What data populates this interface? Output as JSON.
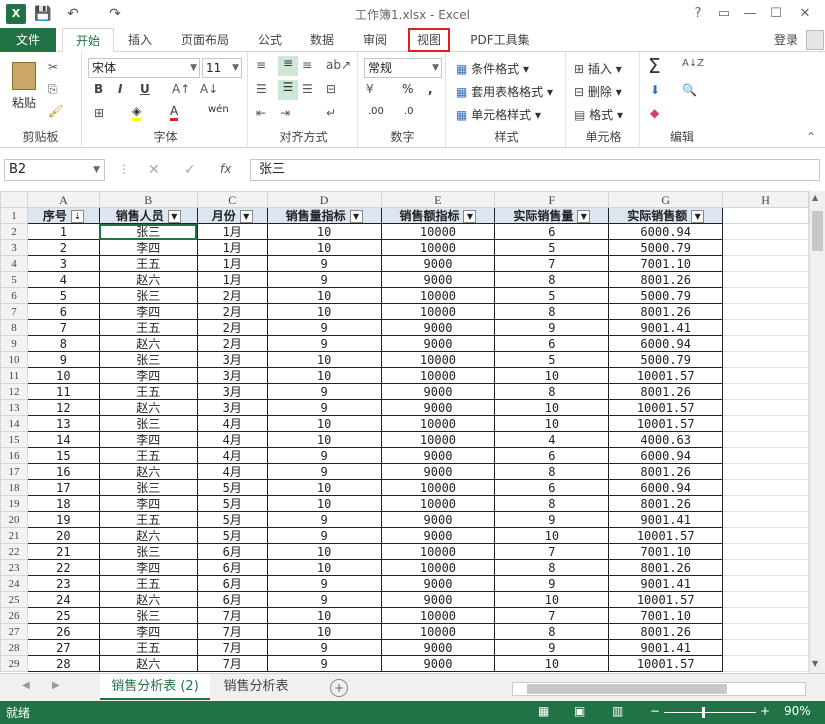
{
  "window": {
    "title": "工作簿1.xlsx - Excel",
    "app_icon": "X",
    "controls": [
      "?",
      "▭",
      "—",
      "☐",
      "✕"
    ]
  },
  "quick_access": {
    "save": "💾",
    "undo": "↶",
    "redo": "↷"
  },
  "tabs": [
    "文件",
    "开始",
    "插入",
    "页面布局",
    "公式",
    "数据",
    "审阅",
    "视图",
    "PDF工具集"
  ],
  "login": "登录",
  "ribbon": {
    "clipboard": {
      "label": "剪贴板",
      "paste": "粘贴"
    },
    "font": {
      "label": "字体",
      "name": "宋体",
      "size": "11",
      "bold": "B",
      "italic": "I",
      "underline": "U",
      "wen": "wén"
    },
    "alignment": {
      "label": "对齐方式"
    },
    "number": {
      "label": "数字",
      "format": "常规",
      "percent": "%",
      "comma": ",",
      "inc": ".00",
      "dec": ".0"
    },
    "styles": {
      "label": "样式",
      "cond": "条件格式",
      "table": "套用表格格式",
      "cell": "单元格样式"
    },
    "cells": {
      "label": "单元格",
      "insert": "插入",
      "delete": "删除",
      "format": "格式"
    },
    "editing": {
      "label": "编辑",
      "sum": "Σ",
      "sort": "A↓Z"
    }
  },
  "formula_bar": {
    "name_box": "B2",
    "fx": "fx",
    "value": "张三"
  },
  "columns": [
    "A",
    "B",
    "C",
    "D",
    "E",
    "F",
    "G",
    "H"
  ],
  "headers": [
    "序号",
    "销售人员",
    "月份",
    "销售量指标",
    "销售额指标",
    "实际销售量",
    "实际销售额"
  ],
  "rows": [
    [
      "1",
      "张三",
      "1月",
      "10",
      "10000",
      "6",
      "6000.94"
    ],
    [
      "2",
      "李四",
      "1月",
      "10",
      "10000",
      "5",
      "5000.79"
    ],
    [
      "3",
      "王五",
      "1月",
      "9",
      "9000",
      "7",
      "7001.10"
    ],
    [
      "4",
      "赵六",
      "1月",
      "9",
      "9000",
      "8",
      "8001.26"
    ],
    [
      "5",
      "张三",
      "2月",
      "10",
      "10000",
      "5",
      "5000.79"
    ],
    [
      "6",
      "李四",
      "2月",
      "10",
      "10000",
      "8",
      "8001.26"
    ],
    [
      "7",
      "王五",
      "2月",
      "9",
      "9000",
      "9",
      "9001.41"
    ],
    [
      "8",
      "赵六",
      "2月",
      "9",
      "9000",
      "6",
      "6000.94"
    ],
    [
      "9",
      "张三",
      "3月",
      "10",
      "10000",
      "5",
      "5000.79"
    ],
    [
      "10",
      "李四",
      "3月",
      "10",
      "10000",
      "10",
      "10001.57"
    ],
    [
      "11",
      "王五",
      "3月",
      "9",
      "9000",
      "8",
      "8001.26"
    ],
    [
      "12",
      "赵六",
      "3月",
      "9",
      "9000",
      "10",
      "10001.57"
    ],
    [
      "13",
      "张三",
      "4月",
      "10",
      "10000",
      "10",
      "10001.57"
    ],
    [
      "14",
      "李四",
      "4月",
      "10",
      "10000",
      "4",
      "4000.63"
    ],
    [
      "15",
      "王五",
      "4月",
      "9",
      "9000",
      "6",
      "6000.94"
    ],
    [
      "16",
      "赵六",
      "4月",
      "9",
      "9000",
      "8",
      "8001.26"
    ],
    [
      "17",
      "张三",
      "5月",
      "10",
      "10000",
      "6",
      "6000.94"
    ],
    [
      "18",
      "李四",
      "5月",
      "10",
      "10000",
      "8",
      "8001.26"
    ],
    [
      "19",
      "王五",
      "5月",
      "9",
      "9000",
      "9",
      "9001.41"
    ],
    [
      "20",
      "赵六",
      "5月",
      "9",
      "9000",
      "10",
      "10001.57"
    ],
    [
      "21",
      "张三",
      "6月",
      "10",
      "10000",
      "7",
      "7001.10"
    ],
    [
      "22",
      "李四",
      "6月",
      "10",
      "10000",
      "8",
      "8001.26"
    ],
    [
      "23",
      "王五",
      "6月",
      "9",
      "9000",
      "9",
      "9001.41"
    ],
    [
      "24",
      "赵六",
      "6月",
      "9",
      "9000",
      "10",
      "10001.57"
    ],
    [
      "25",
      "张三",
      "7月",
      "10",
      "10000",
      "7",
      "7001.10"
    ],
    [
      "26",
      "李四",
      "7月",
      "10",
      "10000",
      "8",
      "8001.26"
    ],
    [
      "27",
      "王五",
      "7月",
      "9",
      "9000",
      "9",
      "9001.41"
    ],
    [
      "28",
      "赵六",
      "7月",
      "9",
      "9000",
      "10",
      "10001.57"
    ]
  ],
  "sheets": [
    "销售分析表 (2)",
    "销售分析表"
  ],
  "status": {
    "ready": "就绪",
    "zoom": "90%"
  },
  "colors": {
    "excel_green": "#217346",
    "header_fill": "#dce6f1",
    "highlight": "#e02020"
  }
}
